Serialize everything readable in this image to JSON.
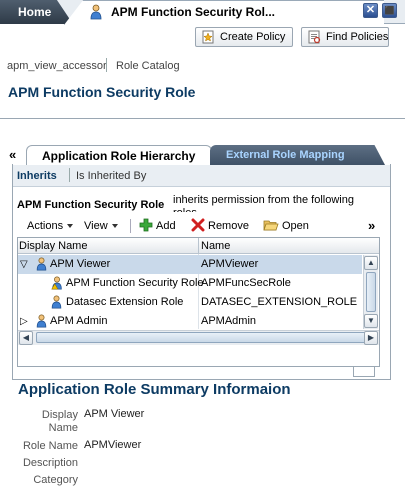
{
  "tabs": {
    "home_label": "Home",
    "active_label": "APM Function Security Rol..."
  },
  "window": {
    "close_glyph": "✕",
    "restore_glyph": "⬛"
  },
  "toolbar": {
    "create_policy": "Create Policy",
    "find_policies": "Find Policies"
  },
  "breadcrumb": {
    "item1": "apm_view_accessor",
    "item2": "Role Catalog"
  },
  "page_title": "APM Function Security Role",
  "subtabs": {
    "collapse_glyph": "«",
    "hierarchy": "Application Role Hierarchy",
    "external": "External Role Mapping"
  },
  "inherit_tabs": {
    "inherits": "Inherits",
    "inherited_by": "Is Inherited By"
  },
  "section": {
    "heading": "APM Function Security Role",
    "description": "inherits permission from the following roles"
  },
  "table_toolbar": {
    "actions": "Actions",
    "view": "View",
    "add": "Add",
    "remove": "Remove",
    "open": "Open",
    "more_glyph": "»"
  },
  "table": {
    "columns": [
      "Display Name",
      "Name"
    ],
    "rows": [
      {
        "display": "APM Viewer",
        "name": "APMViewer",
        "toggle": "▽"
      },
      {
        "display": "APM Function Security Role",
        "name": "APMFuncSecRole"
      },
      {
        "display": "Datasec Extension Role",
        "name": "DATASEC_EXTENSION_ROLE"
      },
      {
        "display": "APM Admin",
        "name": "APMAdmin",
        "toggle": "▷"
      }
    ]
  },
  "summary": {
    "title": "Application Role Summary Informaion",
    "display_name_label": "Display Name",
    "display_name_value": "APM Viewer",
    "role_name_label": "Role Name",
    "role_name_value": "APMViewer",
    "description_label": "Description",
    "category_label": "Category"
  },
  "colors": {
    "title_blue": "#0d3b63",
    "selected_row": "#c9d9ea",
    "tab_dark": "#3f5166"
  }
}
